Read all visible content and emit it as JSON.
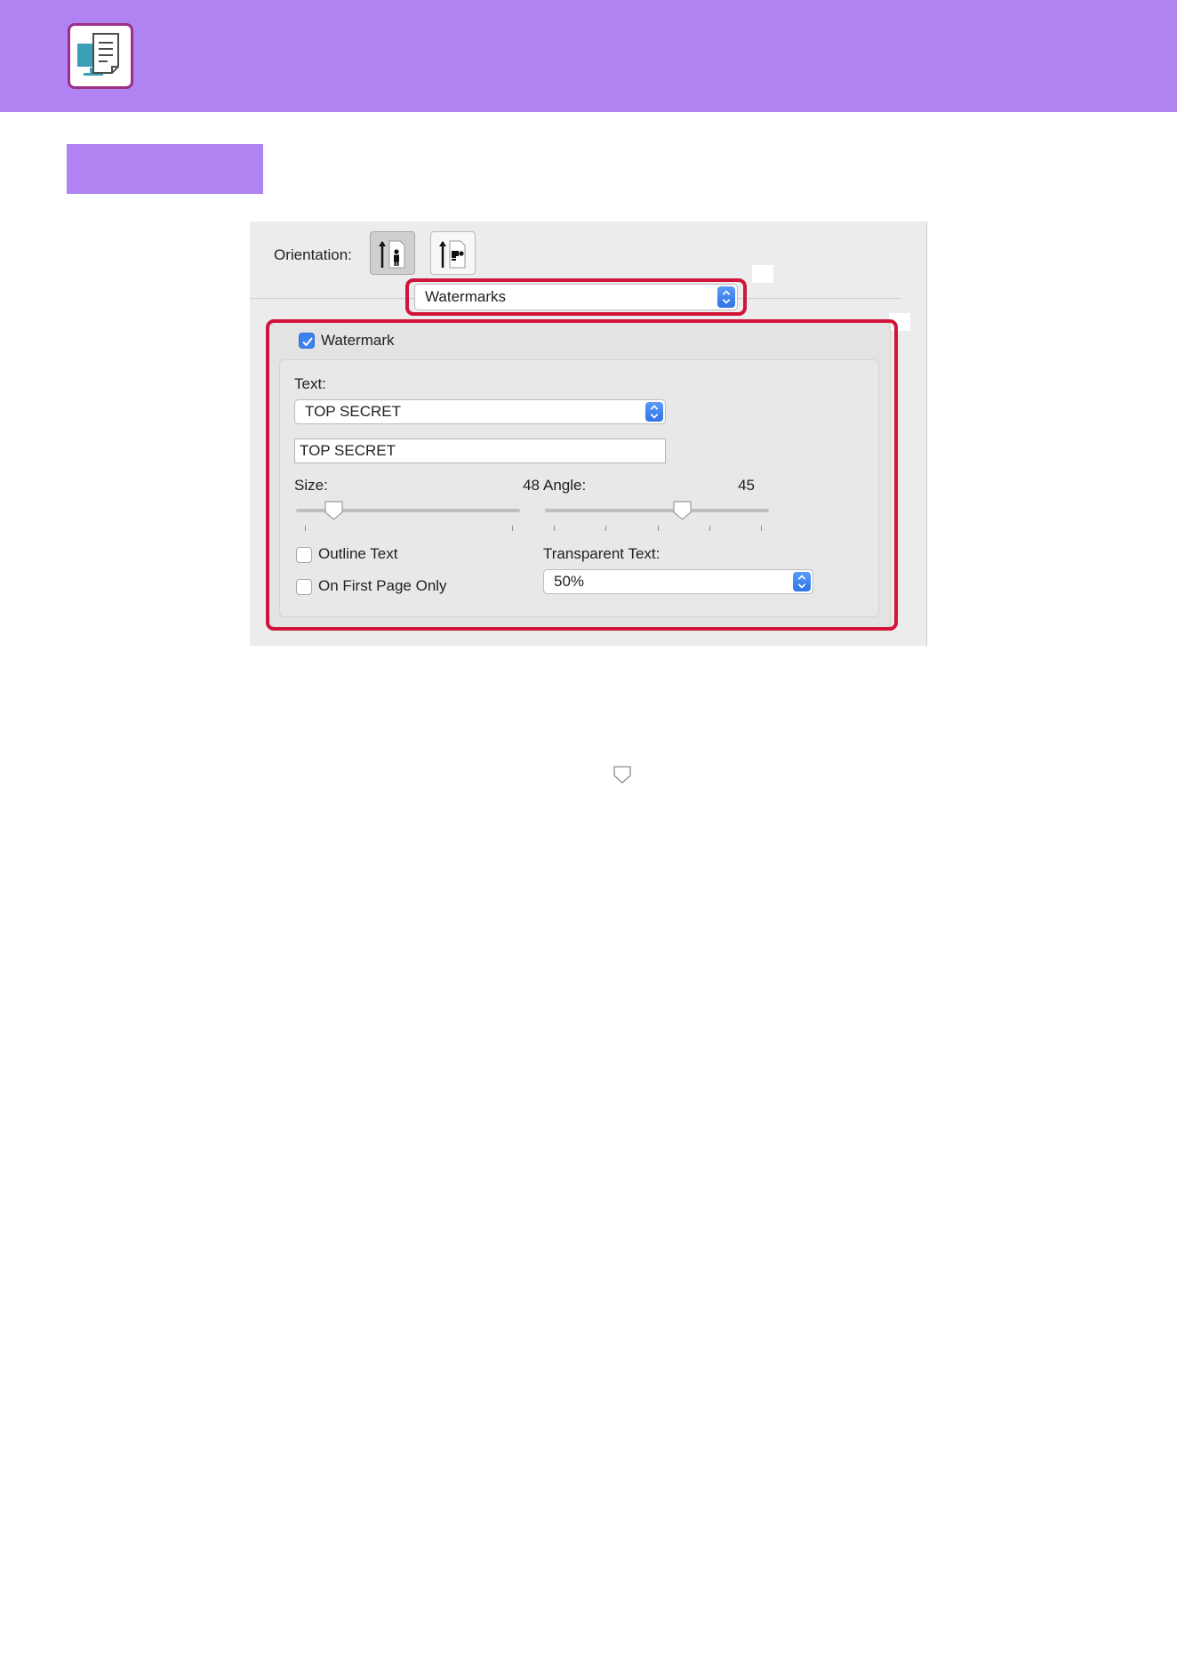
{
  "header": {
    "icon": "document-monitor-icon",
    "accent_color": "#b083f2"
  },
  "dialog": {
    "orientation_label": "Orientation:",
    "orientation_options": [
      {
        "icon": "portrait-orientation-icon",
        "selected": true
      },
      {
        "icon": "landscape-orientation-icon",
        "selected": false
      }
    ],
    "panel_select": {
      "value": "Watermarks"
    },
    "watermark": {
      "enabled": true,
      "checkbox_label": "Watermark",
      "text_label": "Text:",
      "text_preset": "TOP SECRET",
      "text_value": "TOP SECRET",
      "size_label": "Size:",
      "size_value": "48",
      "angle_label": "Angle:",
      "angle_value": "45",
      "size_slider_fraction": 0.17,
      "angle_slider_fraction": 0.615,
      "outline_text": {
        "label": "Outline Text",
        "checked": false
      },
      "first_page_only": {
        "label": "On First Page Only",
        "checked": false
      },
      "transparent_label": "Transparent Text:",
      "transparent_value": "50%"
    }
  },
  "highlight_color": "#d0143a",
  "selection_color": "#3b82f0"
}
